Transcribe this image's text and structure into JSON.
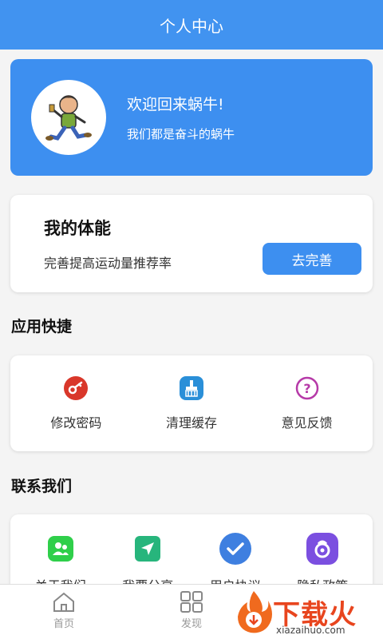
{
  "header": {
    "title": "个人中心"
  },
  "profile": {
    "greeting": "欢迎回来蜗牛!",
    "motto": "我们都是奋斗的蜗牛"
  },
  "fitness": {
    "title": "我的体能",
    "subtitle": "完善提高运动量推荐率",
    "button_label": "去完善"
  },
  "quick": {
    "title": "应用快捷",
    "items": [
      {
        "label": "修改密码",
        "icon": "key-icon",
        "color": "#d9372a"
      },
      {
        "label": "清理缓存",
        "icon": "broom-icon",
        "color": "#2a8fd8"
      },
      {
        "label": "意见反馈",
        "icon": "question-icon",
        "color": "#b63aa8"
      }
    ]
  },
  "contact": {
    "title": "联系我们",
    "items": [
      {
        "label": "关于我们",
        "icon": "people-icon",
        "color": "#2fcf4a"
      },
      {
        "label": "我要分享",
        "icon": "send-icon",
        "color": "#27b57c"
      },
      {
        "label": "用户协议",
        "icon": "check-icon",
        "color": "#3e7fe0"
      },
      {
        "label": "隐私政策",
        "icon": "lock-icon",
        "color": "#7b4fe0"
      }
    ]
  },
  "tabbar": {
    "items": [
      {
        "label": "首页",
        "icon": "home-icon"
      },
      {
        "label": "发现",
        "icon": "grid-icon"
      }
    ]
  },
  "watermark": {
    "brand": "下载火",
    "url": "xiazaihuo.com"
  }
}
